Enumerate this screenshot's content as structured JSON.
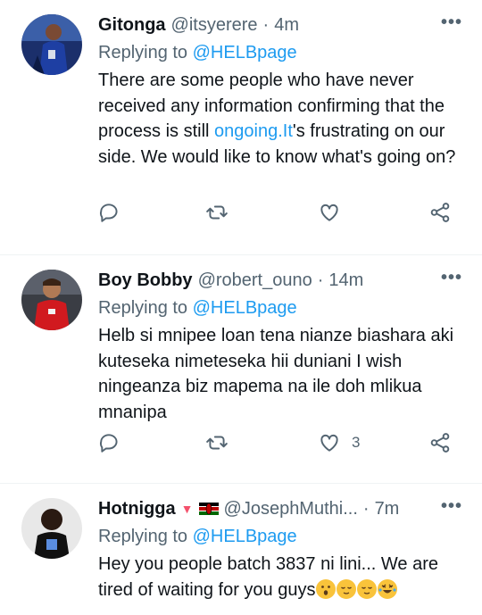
{
  "tweets": [
    {
      "name": "Gitonga",
      "handle": "@itsyerere",
      "time": "4m",
      "replying_prefix": "Replying to",
      "replying_to": "@HELBpage",
      "text_parts": [
        "There are some people who have never received any information confirming that the process is still ",
        "ongoing.It",
        "'s frustrating on our side. We would like to know what's going on?"
      ],
      "like_count": ""
    },
    {
      "name": "Boy Bobby",
      "handle": "@robert_ouno",
      "time": "14m",
      "replying_prefix": "Replying to",
      "replying_to": "@HELBpage",
      "text": "Helb si mnipee loan tena nianze biashara aki kuteseka nimeteseka hii duniani I wish ningeanza biz mapema na ile doh mlikua mnanipa",
      "like_count": "3"
    },
    {
      "name": "Hotnigga",
      "handle": "@JosephMuthi...",
      "time": "7m",
      "replying_prefix": "Replying to",
      "replying_to": "@HELBpage",
      "text": "Hey you people batch 3837 ni lini... We are tired of waiting for you guys",
      "emojis": [
        "astonished-face",
        "relieved-face",
        "relieved-face",
        "rolling-laughing-face"
      ],
      "name_decorations": [
        "red-triangle-icon",
        "kenya-flag-icon"
      ]
    }
  ],
  "separator": "·",
  "more_label": "•••",
  "colors": {
    "link": "#1d9bf0",
    "secondary": "#536471",
    "text": "#0f1419"
  }
}
